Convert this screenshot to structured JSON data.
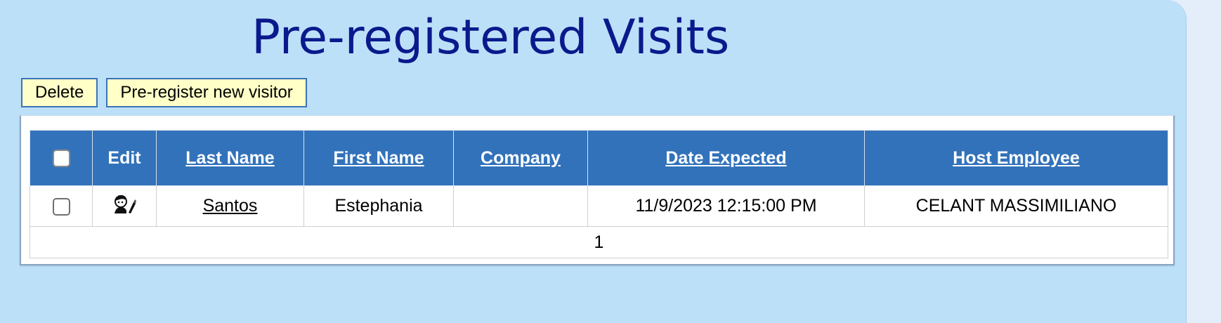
{
  "page": {
    "title": "Pre-registered Visits"
  },
  "toolbar": {
    "delete_label": "Delete",
    "new_visitor_label": "Pre-register new visitor"
  },
  "grid": {
    "columns": {
      "select": "",
      "edit": "Edit",
      "last_name": "Last Name",
      "first_name": "First Name",
      "company": "Company",
      "date_expected": "Date Expected",
      "host_employee": "Host Employee"
    },
    "rows": [
      {
        "selected": false,
        "edit_icon": "edit-user-icon",
        "last_name": "Santos",
        "first_name": "Estephania",
        "company": "",
        "date_expected": "11/9/2023 12:15:00 PM",
        "host_employee": "CELANT MASSIMILIANO"
      }
    ],
    "pager": {
      "current_page": "1"
    }
  },
  "colors": {
    "panel_background": "#bde0f9",
    "title": "#0a1a8c",
    "header_background": "#3272ba",
    "button_background": "#ffffc8"
  }
}
